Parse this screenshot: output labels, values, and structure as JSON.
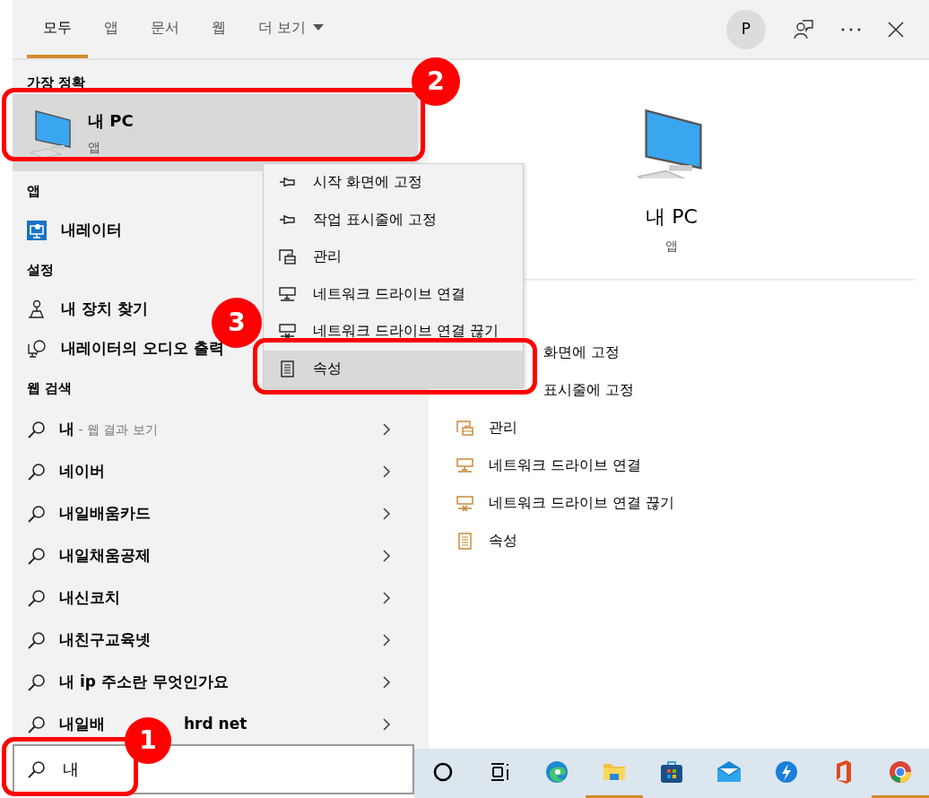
{
  "tabs": [
    {
      "label": "모두",
      "selected": true,
      "kind": "tab"
    },
    {
      "label": "앱",
      "selected": false,
      "kind": "tab"
    },
    {
      "label": "문서",
      "selected": false,
      "kind": "tab"
    },
    {
      "label": "웹",
      "selected": false,
      "kind": "tab"
    },
    {
      "label": "더 보기",
      "selected": false,
      "kind": "dropdown"
    }
  ],
  "account": {
    "initial": "P"
  },
  "best_match": {
    "heading": "가장 정확",
    "title": "내 PC",
    "subtitle": "앱",
    "selected": true
  },
  "sections": [
    {
      "heading": "앱",
      "items": [
        {
          "kind": "narrator",
          "label": "내레이터"
        }
      ]
    },
    {
      "heading": "설정",
      "items": [
        {
          "kind": "device",
          "label": "내 장치 찾기"
        },
        {
          "kind": "audio",
          "label": "내레이터의 오디오 출력"
        }
      ]
    },
    {
      "heading": "웹 검색",
      "items": [
        {
          "kind": "web",
          "label": "내",
          "hint": "- 웹 결과 보기"
        },
        {
          "kind": "web",
          "label": "네이버"
        },
        {
          "kind": "web",
          "label": "내일배움카드"
        },
        {
          "kind": "web",
          "label": "내일채움공제"
        },
        {
          "kind": "web",
          "label": "내신코치"
        },
        {
          "kind": "web",
          "label": "내친구교육넷"
        },
        {
          "kind": "web",
          "label": "내 ip 주소란 무엇인가요"
        },
        {
          "kind": "web",
          "label": "내일배",
          "tail": "hrd net"
        }
      ]
    }
  ],
  "context_menu": {
    "items": [
      {
        "kind": "pin",
        "label": "시작 화면에 고정",
        "selected": false
      },
      {
        "kind": "pin",
        "label": "작업 표시줄에 고정",
        "selected": false
      },
      {
        "kind": "manage",
        "label": "관리",
        "selected": false
      },
      {
        "kind": "drive",
        "label": "네트워크 드라이브 연결",
        "selected": false
      },
      {
        "kind": "disconnect",
        "label": "네트워크 드라이브 연결 끊기",
        "selected": false
      },
      {
        "kind": "properties",
        "label": "속성",
        "selected": true
      }
    ]
  },
  "preview": {
    "title": "내 PC",
    "subtitle": "앱",
    "actions": [
      {
        "kind": "covered",
        "label": "화면에 고정"
      },
      {
        "kind": "covered",
        "label": "표시줄에 고정"
      },
      {
        "kind": "manage",
        "label": "관리"
      },
      {
        "kind": "drive",
        "label": "네트워크 드라이브 연결"
      },
      {
        "kind": "disconnect",
        "label": "네트워크 드라이브 연결 끊기"
      },
      {
        "kind": "properties",
        "label": "속성"
      }
    ]
  },
  "search": {
    "value": "내"
  },
  "taskbar": [
    {
      "kind": "cortana",
      "active": false
    },
    {
      "kind": "taskview",
      "active": false
    },
    {
      "kind": "edge",
      "active": false
    },
    {
      "kind": "folder",
      "active": true
    },
    {
      "kind": "store",
      "active": false
    },
    {
      "kind": "mail",
      "active": false
    },
    {
      "kind": "bolt",
      "active": false
    },
    {
      "kind": "office",
      "active": false
    },
    {
      "kind": "chrome",
      "active": true
    }
  ],
  "annotations": [
    {
      "number": "1"
    },
    {
      "number": "2"
    },
    {
      "number": "3"
    }
  ]
}
